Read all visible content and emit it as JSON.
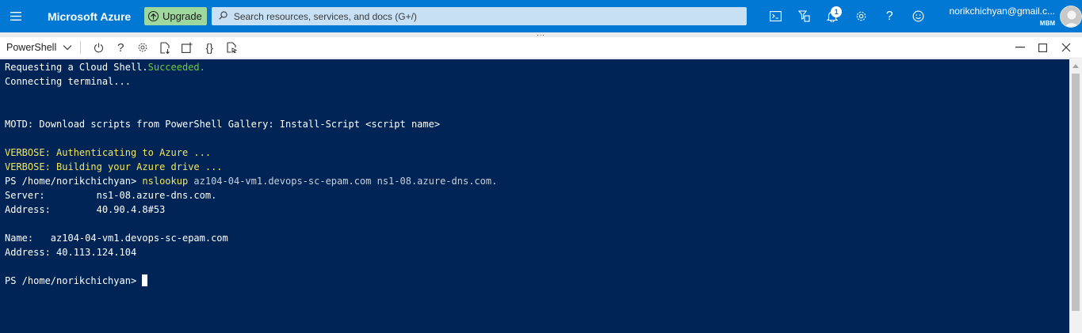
{
  "topbar": {
    "menu_icon": "hamburger-icon",
    "brand": "Microsoft Azure",
    "upgrade_label": "Upgrade",
    "search_placeholder": "Search resources, services, and docs (G+/)",
    "notifications_count": "1",
    "icons": [
      "cloud-shell-icon",
      "directory-filter-icon",
      "notifications-icon",
      "settings-icon",
      "help-icon",
      "feedback-icon"
    ],
    "account_email": "norikchichyan@gmail.c...",
    "account_directory": "MBM"
  },
  "shell": {
    "shell_type": "PowerShell",
    "tools": [
      "power-icon",
      "help-icon",
      "settings-icon",
      "upload-download-icon",
      "new-session-icon",
      "editor-braces-icon",
      "web-preview-icon"
    ],
    "window_controls": [
      "minimize-icon",
      "maximize-icon",
      "close-icon"
    ]
  },
  "terminal": {
    "line1_prefix": "Requesting a Cloud Shell.",
    "line1_status": "Succeeded.",
    "line2": "Connecting terminal...",
    "motd": "MOTD: Download scripts from PowerShell Gallery: Install-Script <script name>",
    "verbose1": "VERBOSE: Authenticating to Azure ...",
    "verbose2": "VERBOSE: Building your Azure drive ...",
    "prompt": "PS /home/norikchichyan> ",
    "command": "nslookup",
    "command_args": " az104-04-vm1.devops-sc-epam.com ns1-08.azure-dns.com.",
    "server_line": "Server:         ns1-08.azure-dns.com.",
    "address_line": "Address:        40.90.4.8#53",
    "name_line": "Name:   az104-04-vm1.devops-sc-epam.com",
    "address2_line": "Address: 40.113.124.104",
    "final_prompt": "PS /home/norikchichyan> "
  },
  "colors": {
    "topbar": "#0078d4",
    "terminal_bg": "#012456",
    "success": "#6ecb3b",
    "verbose": "#f2e55c"
  }
}
